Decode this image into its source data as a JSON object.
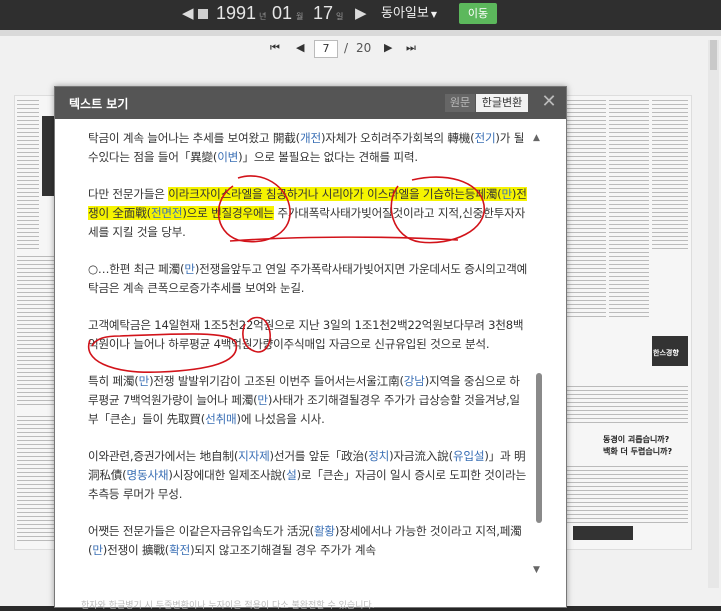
{
  "datebar": {
    "year": "1991",
    "year_unit": "년",
    "month": "01",
    "month_unit": "월",
    "day": "17",
    "day_unit": "일",
    "paper": "동아일보",
    "go_label": "이동"
  },
  "pager": {
    "current": "7",
    "separator": "/",
    "total": "20"
  },
  "scan_ad": {
    "line1": "한스경향",
    "line2": "동경이 괴롭습니까?",
    "line3": "백화 더 두렵습니까?"
  },
  "modal": {
    "title": "텍스트 보기",
    "tab_original": "원문",
    "tab_converted": "한글변환",
    "footer": "한자와 한글병기 시 두줄변환이나 누자이은 적용이 다소 불완전할 수 있습니다."
  },
  "colors": {
    "hanja_reading": "#3a6fb5",
    "highlight": "#f6f400",
    "ink": "#d2131a",
    "go_button": "#5cb85c"
  },
  "paragraphs": [
    [
      {
        "t": "탁금이 계속 늘어나는 추세를 보여왔고 開截("
      },
      {
        "t": "개전",
        "h": true
      },
      {
        "t": ")자체가 오히려주가회복의 轉機("
      },
      {
        "t": "전기",
        "h": true
      },
      {
        "t": ")가 될수있다는 점을 들어「異變("
      },
      {
        "t": "이변",
        "h": true
      },
      {
        "t": ")」으로 볼필요는 없다는 견해를 피력."
      }
    ],
    [
      {
        "t": " 다만 전문가들은 "
      },
      {
        "t": "이라크자이스라엘을 침공하거나 시리아가 이스라엘을 기습하는등페濁(",
        "m": true
      },
      {
        "t": "만",
        "h": true,
        "m": true
      },
      {
        "t": ")전쟁이 全面戰(",
        "m": true
      },
      {
        "t": "전면전",
        "h": true,
        "m": true
      },
      {
        "t": ")으로 번질경우에는",
        "m": true
      },
      {
        "t": " 주가대폭락사태가빚어질것이라고 지적,신중한투자자세를 지킬 것을 당부."
      }
    ],
    [
      {
        "t": " ○…한편 최근 페濁("
      },
      {
        "t": "만",
        "h": true
      },
      {
        "t": ")전쟁을앞두고 연일 주가폭락사태가빚어지면 가운데서도 증시의고객예탁금은 계속 큰폭으로증가추세를 보여와 눈길."
      }
    ],
    [
      {
        "t": " 고객예탁금은 14일현재 1조5천22억원으로 지난 3일의 1조1천2백22억원보다무려 3천8백억원이나 늘어나 하루평균 4백억원가량이주식매입 자금으로 신규유입된 것으로 분석."
      }
    ],
    [
      {
        "t": " 특히 페濁("
      },
      {
        "t": "만",
        "h": true
      },
      {
        "t": ")전쟁 발발위기감이 고조된 이번주 들어서는서울江南("
      },
      {
        "t": "강남",
        "h": true
      },
      {
        "t": ")지역을 중심으로 하루평균 7백억원가량이 늘어나 페濁("
      },
      {
        "t": "만",
        "h": true
      },
      {
        "t": ")사태가 조기해결될경우 주가가 급상승할 것을겨냥,일부「큰손」들이 先取買("
      },
      {
        "t": "선취매",
        "h": true
      },
      {
        "t": ")에 나섰음을 시사."
      }
    ],
    [
      {
        "t": " 이와관련,증권가에서는 地自制("
      },
      {
        "t": "지자제",
        "h": true
      },
      {
        "t": ")선거를 앞둔「政治("
      },
      {
        "t": "정치",
        "h": true
      },
      {
        "t": ")자금流入說("
      },
      {
        "t": "유입설",
        "h": true
      },
      {
        "t": ")」과 明洞私債("
      },
      {
        "t": "명동사채",
        "h": true
      },
      {
        "t": ")시장에대한 일제조사說("
      },
      {
        "t": "설",
        "h": true
      },
      {
        "t": ")로「큰손」자금이 일시 증시로 도피한 것이라는 추측등 루머가 무성."
      }
    ],
    [
      {
        "t": " 어쨋든 전문가들은 이같은자금유입속도가 活況("
      },
      {
        "t": "활황",
        "h": true
      },
      {
        "t": ")장세에서나 가능한 것이라고 지적,페濁("
      },
      {
        "t": "만",
        "h": true
      },
      {
        "t": ")전쟁이 擴戰("
      },
      {
        "t": "확전",
        "h": true
      },
      {
        "t": ")되지 않고조기해결될 경우 주가가 계속"
      }
    ]
  ]
}
